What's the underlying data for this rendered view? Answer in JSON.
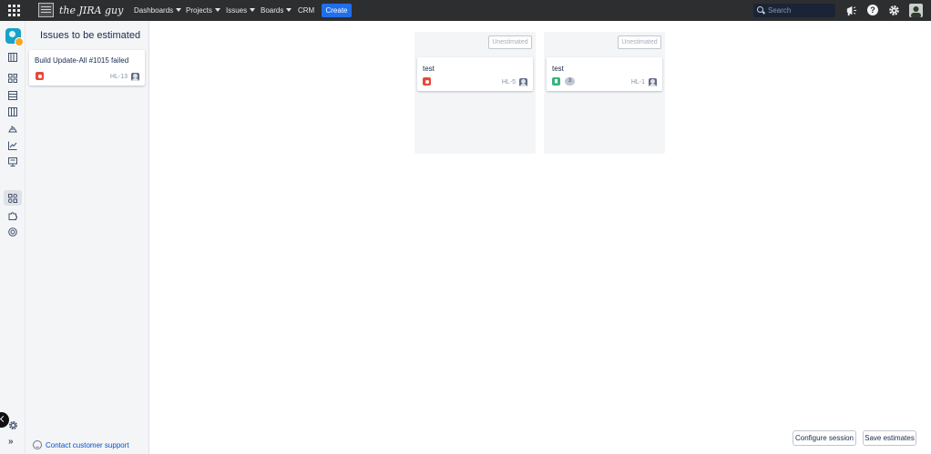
{
  "topnav": {
    "logo_text": "the JIRA guy",
    "items": [
      {
        "label": "Dashboards"
      },
      {
        "label": "Projects"
      },
      {
        "label": "Issues"
      },
      {
        "label": "Boards"
      },
      {
        "label": "CRM"
      }
    ],
    "create_label": "Create",
    "search_placeholder": "Search",
    "icons": [
      "apps-grid-icon",
      "megaphone-icon",
      "help-icon",
      "gear-icon",
      "user-avatar"
    ]
  },
  "rail": {
    "icons": [
      "app-logo",
      "backlog-icon",
      "board-icon",
      "list-icon",
      "columns-icon",
      "releases-icon",
      "reports-icon",
      "monitor-icon",
      "estimation-icon",
      "puzzle-icon",
      "target-icon",
      "settings-icon",
      "expand-icon"
    ]
  },
  "panel": {
    "title": "Issues to be estimated",
    "cards": [
      {
        "summary": "Build Update-All #1015 failed",
        "type": "bug",
        "key": "HL-13"
      }
    ],
    "contact_label": "Contact customer support",
    "expand_label": "»"
  },
  "columns": [
    {
      "estimate_label": "Unestimated",
      "cards": [
        {
          "summary": "test",
          "type": "bug",
          "key": "HL-5"
        }
      ]
    },
    {
      "estimate_label": "Unestimated",
      "cards": [
        {
          "summary": "test",
          "type": "story",
          "key": "HL-1",
          "points": "3"
        }
      ]
    }
  ],
  "actions": {
    "configure_label": "Configure session",
    "save_label": "Save estimates"
  },
  "colors": {
    "topbar": "#2d2e30",
    "create": "#1f6fea",
    "bug": "#e5493a",
    "story": "#36b37e",
    "panel_bg": "#f4f5f7"
  }
}
